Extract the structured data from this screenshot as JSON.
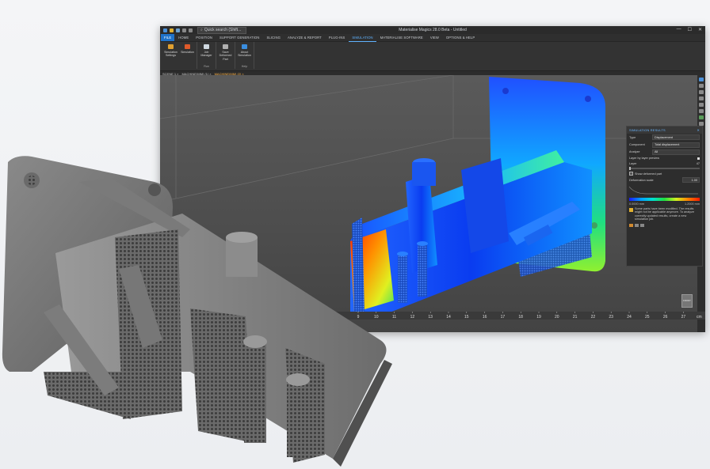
{
  "titlebar": {
    "search_placeholder": "Quick search (Shift...",
    "window_title": "Materialise Magics 28.0 Beta - Untitled",
    "min": "—",
    "max": "☐",
    "close": "✕"
  },
  "menu": {
    "items": [
      "FILE",
      "HOME",
      "POSITION",
      "SUPPORT GENERATION",
      "SLICING",
      "ANALYZE & REPORT",
      "PLUG-INS",
      "SIMULATION",
      "MATERIALISE SOFTWARE",
      "VIEW",
      "OPTIONS & HELP"
    ],
    "active": "SIMULATION"
  },
  "ribbon": {
    "groups": [
      {
        "name": "",
        "buttons": [
          {
            "label": "Simulation Settings",
            "icon": "settings-icon",
            "color": "#e0a030"
          },
          {
            "label": "Simulation",
            "icon": "simulation-icon",
            "color": "#e05a2a"
          }
        ]
      },
      {
        "name": "Run",
        "buttons": [
          {
            "label": "Job Manager",
            "icon": "job-manager-icon",
            "color": "#cfd8e0"
          }
        ]
      },
      {
        "name": "",
        "buttons": [
          {
            "label": "Save Deformed Part",
            "icon": "save-part-icon",
            "color": "#b0b0b0"
          }
        ]
      },
      {
        "name": "Help",
        "buttons": [
          {
            "label": "About Simulation",
            "icon": "info-icon",
            "color": "#3a8ee0"
          }
        ]
      }
    ]
  },
  "tabs": [
    {
      "label": "SCENE 1",
      "selected": false
    },
    {
      "label": "MACHINE(MM) (1)",
      "selected": false
    },
    {
      "label": "MACHINE(MM) (2)",
      "selected": true
    }
  ],
  "simulation_panel": {
    "title": "SIMULATION RESULTS",
    "rows": [
      {
        "label": "Type",
        "value": "Displacement"
      },
      {
        "label": "Component",
        "value": "Total displacement"
      },
      {
        "label": "Analyze",
        "value": "All"
      }
    ],
    "layer_checkbox": "Layer by layer preview",
    "layer_label": "Layer",
    "layer_value": "47",
    "deformed_checkbox": "Show deformed part",
    "deformation_scale_label": "Deformation scale",
    "deformation_scale_value": "1.00",
    "legend_min": "0.0000 mm",
    "legend_max": "1.2000 mm",
    "warning": "Some parts have been modified. The results might not be applicable anymore. To analyze correctly updated results, create a new simulation job."
  },
  "ruler": {
    "ticks": [
      "9",
      "10",
      "11",
      "12",
      "13",
      "14",
      "15",
      "16",
      "17",
      "18",
      "19",
      "20",
      "21",
      "22",
      "23",
      "24",
      "25",
      "26",
      "27"
    ],
    "unit": "cm"
  },
  "viewcube_label": "FRONT",
  "colors": {
    "accent": "#1f72c9",
    "active_tab": "#5fb3ff",
    "hot": "#ff1a00",
    "cold": "#1a1aff"
  }
}
